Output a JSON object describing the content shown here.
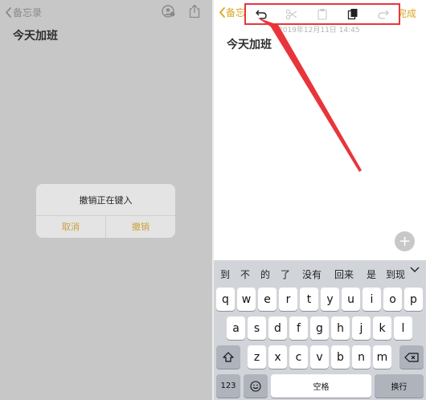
{
  "left": {
    "back_label": "备忘录",
    "note_title": "今天加班",
    "alert": {
      "title": "撤销正在键入",
      "cancel": "取消",
      "undo": "撤销"
    }
  },
  "right": {
    "back_label": "备忘",
    "done_label": "完成",
    "timestamp": "2019年12月11日 14:45",
    "note_title": "今天加班",
    "fab": "+",
    "candidates": [
      "到",
      "不",
      "的",
      "了",
      "没有",
      "回来",
      "是",
      "到现"
    ],
    "keyboard": {
      "row1": [
        "q",
        "w",
        "e",
        "r",
        "t",
        "y",
        "u",
        "i",
        "o",
        "p"
      ],
      "row2": [
        "a",
        "s",
        "d",
        "f",
        "g",
        "h",
        "j",
        "k",
        "l"
      ],
      "row3": [
        "z",
        "x",
        "c",
        "v",
        "b",
        "n",
        "m"
      ],
      "numbers_key": "123",
      "space_key": "空格",
      "return_key": "换行"
    }
  },
  "colors": {
    "accent": "#d9a820",
    "highlight": "#e8353b",
    "dim_overlay": "#c7c7c7"
  },
  "icons": [
    "chevron-left-icon",
    "people-icon",
    "share-icon",
    "undo-icon",
    "scissors-icon",
    "paste-icon",
    "copy-icon",
    "redo-icon",
    "shift-icon",
    "emoji-icon",
    "backspace-icon",
    "chevron-down-icon"
  ]
}
